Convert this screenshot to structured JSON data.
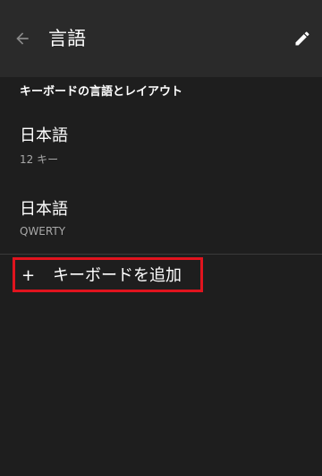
{
  "toolbar": {
    "title": "言語",
    "back_icon": "arrow-left-icon",
    "edit_icon": "pencil-icon"
  },
  "section": {
    "header": "キーボードの言語とレイアウト"
  },
  "keyboards": [
    {
      "title": "日本語",
      "subtitle": "12 キー"
    },
    {
      "title": "日本語",
      "subtitle": "QWERTY"
    }
  ],
  "add_keyboard": {
    "icon": "+",
    "label": "キーボードを追加"
  },
  "colors": {
    "background": "#1e1e1e",
    "toolbar": "#2a2a2a",
    "subtitle": "#a8a8a8",
    "highlight_border": "#e0141e"
  }
}
